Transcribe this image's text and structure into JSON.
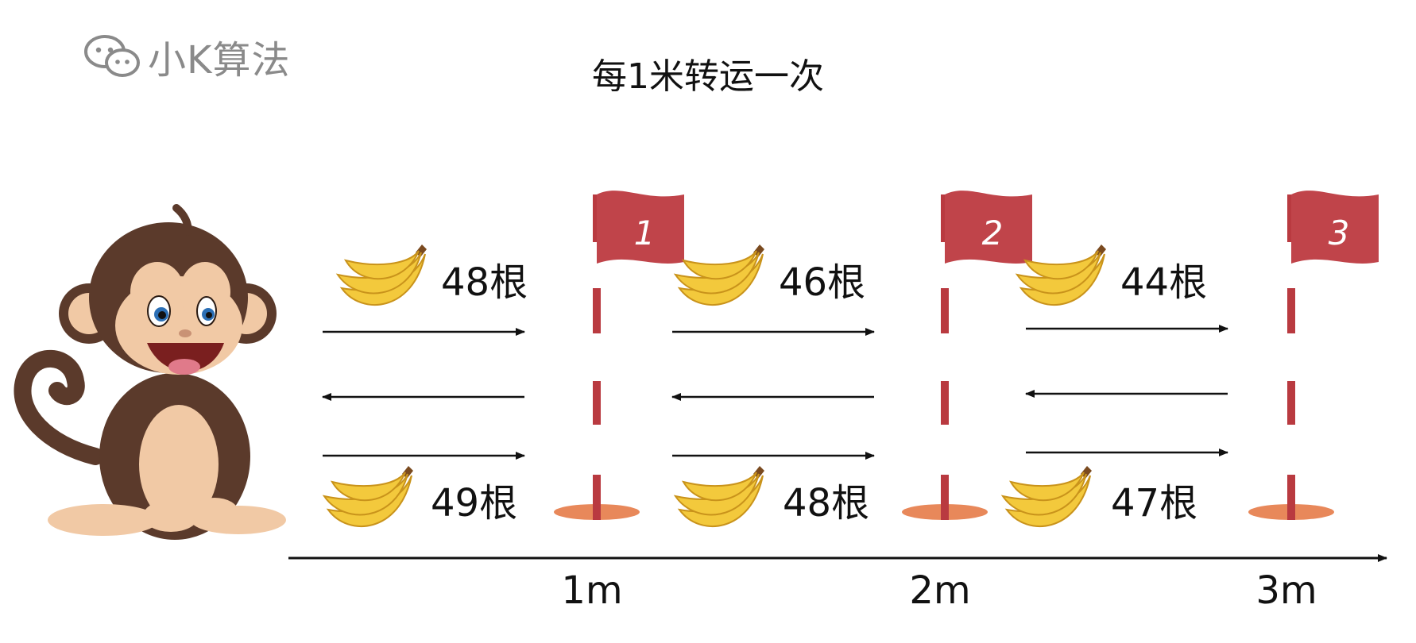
{
  "brand": {
    "name": "小K算法",
    "icon": "wechat-icon",
    "color": "#8a8a8a"
  },
  "title": "每1米转运一次",
  "colors": {
    "flag": "#c0444a",
    "pole": "#b93a40",
    "hole": "#e8885a",
    "arrow": "#111111",
    "banana": "#f3c93c",
    "banana_edge": "#c9931b",
    "monkey_fur": "#5b3a2b",
    "monkey_skin": "#f1c9a5"
  },
  "markers": [
    {
      "flag_label": "1",
      "distance_label": "1m"
    },
    {
      "flag_label": "2",
      "distance_label": "2m"
    },
    {
      "flag_label": "3",
      "distance_label": "3m"
    }
  ],
  "segments": [
    {
      "top_count": "48根",
      "bottom_count": "49根"
    },
    {
      "top_count": "46根",
      "bottom_count": "48根"
    },
    {
      "top_count": "44根",
      "bottom_count": "47根"
    }
  ],
  "arrow_pattern": [
    "right",
    "left",
    "right"
  ]
}
